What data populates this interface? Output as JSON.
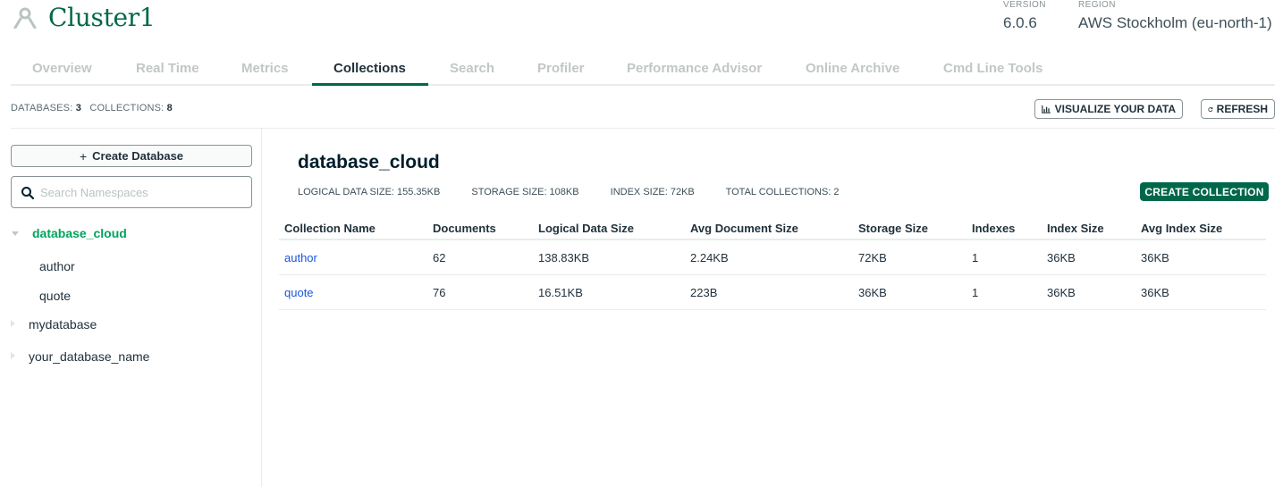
{
  "header": {
    "cluster_name": "Cluster1",
    "version_label": "VERSION",
    "version_value": "6.0.6",
    "region_label": "REGION",
    "region_value": "AWS Stockholm (eu-north-1)"
  },
  "tabs": [
    {
      "label": "Overview",
      "active": false
    },
    {
      "label": "Real Time",
      "active": false
    },
    {
      "label": "Metrics",
      "active": false
    },
    {
      "label": "Collections",
      "active": true
    },
    {
      "label": "Search",
      "active": false
    },
    {
      "label": "Profiler",
      "active": false
    },
    {
      "label": "Performance Advisor",
      "active": false
    },
    {
      "label": "Online Archive",
      "active": false
    },
    {
      "label": "Cmd Line Tools",
      "active": false
    }
  ],
  "stats": {
    "databases_label": "DATABASES:",
    "databases_value": "3",
    "collections_label": "COLLECTIONS:",
    "collections_value": "8"
  },
  "actions": {
    "visualize_label": "VISUALIZE YOUR DATA",
    "refresh_label": "REFRESH"
  },
  "sidebar": {
    "create_db_label": "Create Database",
    "search_placeholder": "Search Namespaces",
    "databases": [
      {
        "name": "database_cloud",
        "expanded": true,
        "collections": [
          "author",
          "quote"
        ]
      },
      {
        "name": "mydatabase",
        "expanded": false
      },
      {
        "name": "your_database_name",
        "expanded": false
      }
    ]
  },
  "main": {
    "db_name": "database_cloud",
    "logical_size_label": "LOGICAL DATA SIZE:",
    "logical_size_value": "155.35KB",
    "storage_size_label": "STORAGE SIZE:",
    "storage_size_value": "108KB",
    "index_size_label": "INDEX SIZE:",
    "index_size_value": "72KB",
    "total_collections_label": "TOTAL COLLECTIONS:",
    "total_collections_value": "2",
    "create_collection_label": "CREATE COLLECTION",
    "table": {
      "headers": [
        "Collection Name",
        "Documents",
        "Logical Data Size",
        "Avg Document Size",
        "Storage Size",
        "Indexes",
        "Index Size",
        "Avg Index Size"
      ],
      "rows": [
        [
          "author",
          "62",
          "138.83KB",
          "2.24KB",
          "72KB",
          "1",
          "36KB",
          "36KB"
        ],
        [
          "quote",
          "76",
          "16.51KB",
          "223B",
          "36KB",
          "1",
          "36KB",
          "36KB"
        ]
      ]
    }
  },
  "colors": {
    "brand_green": "#00684a",
    "active_db_green": "#00a35c",
    "link_blue": "#1a56db"
  }
}
